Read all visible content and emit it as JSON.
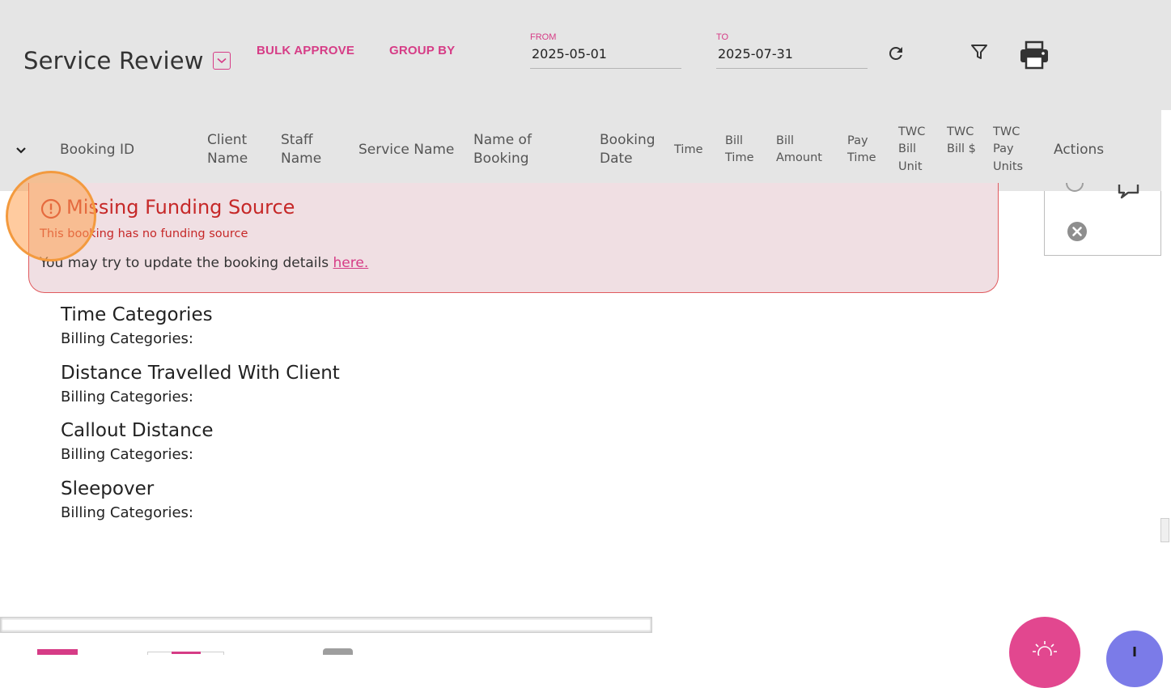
{
  "header": {
    "title": "Service Review",
    "bulk_approve_label": "BULK APPROVE",
    "group_by_label": "GROUP BY",
    "from": {
      "label": "FROM",
      "value": "2025-05-01"
    },
    "to": {
      "label": "TO",
      "value": "2025-07-31"
    }
  },
  "columns": [
    "Booking ID",
    "Client Name",
    "Staff Name",
    "Service Name",
    "Name of Booking",
    "Booking Date",
    "Time",
    "Bill Time",
    "Bill Amount",
    "Pay Time",
    "TWC Bill Unit",
    "TWC Bill $",
    "TWC Pay Units",
    "Actions"
  ],
  "alert": {
    "title": "Missing Funding Source",
    "subtitle": "This booking has no funding source",
    "message": "You may try to update the booking details ",
    "link_text": "here."
  },
  "categories": [
    {
      "title": "Time Categories",
      "sub": "Billing Categories:"
    },
    {
      "title": "Distance Travelled With Client",
      "sub": "Billing Categories:"
    },
    {
      "title": "Callout Distance",
      "sub": "Billing Categories:"
    },
    {
      "title": "Sleepover",
      "sub": "Billing Categories:"
    }
  ],
  "colors": {
    "accent": "#d63c86",
    "header_bg": "#e5e5e5",
    "alert_bg": "#f0dfe3",
    "alert_text": "#c62828",
    "fab_pink": "#e2478f",
    "fab_purple": "#7b7be8"
  },
  "icons": {
    "refresh": "refresh-icon",
    "filter": "filter-icon",
    "print": "print-icon",
    "expand": "chevron-down-icon",
    "alert": "alert-circle-icon",
    "cancel": "close-circle-icon",
    "comment": "comment-icon"
  }
}
